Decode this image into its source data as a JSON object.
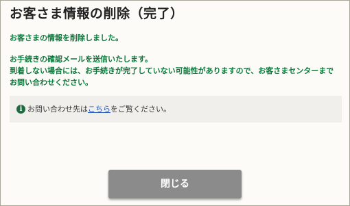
{
  "page": {
    "title": "お客さま情報の削除（完了）"
  },
  "messages": {
    "deleted": "お客さまの情報を削除しました。",
    "email_sent": "お手続きの確認メールを送信いたします。",
    "not_arrived_line1": "到着しない場合には、お手続きが完了していない可能性がありますので、お客さまセンターまで",
    "not_arrived_line2": "お問い合わせください。"
  },
  "info": {
    "icon": "info-icon",
    "icon_glyph": "i",
    "text_before": "お問い合わせ先は",
    "link_text": "こちら",
    "text_after": "をご覧ください。"
  },
  "buttons": {
    "close_label": "閉じる"
  },
  "colors": {
    "message_green": "#0d7a3d",
    "link_blue": "#2457b8",
    "button_gray": "#8b8b8b",
    "info_box_bg": "#f0efeb"
  }
}
